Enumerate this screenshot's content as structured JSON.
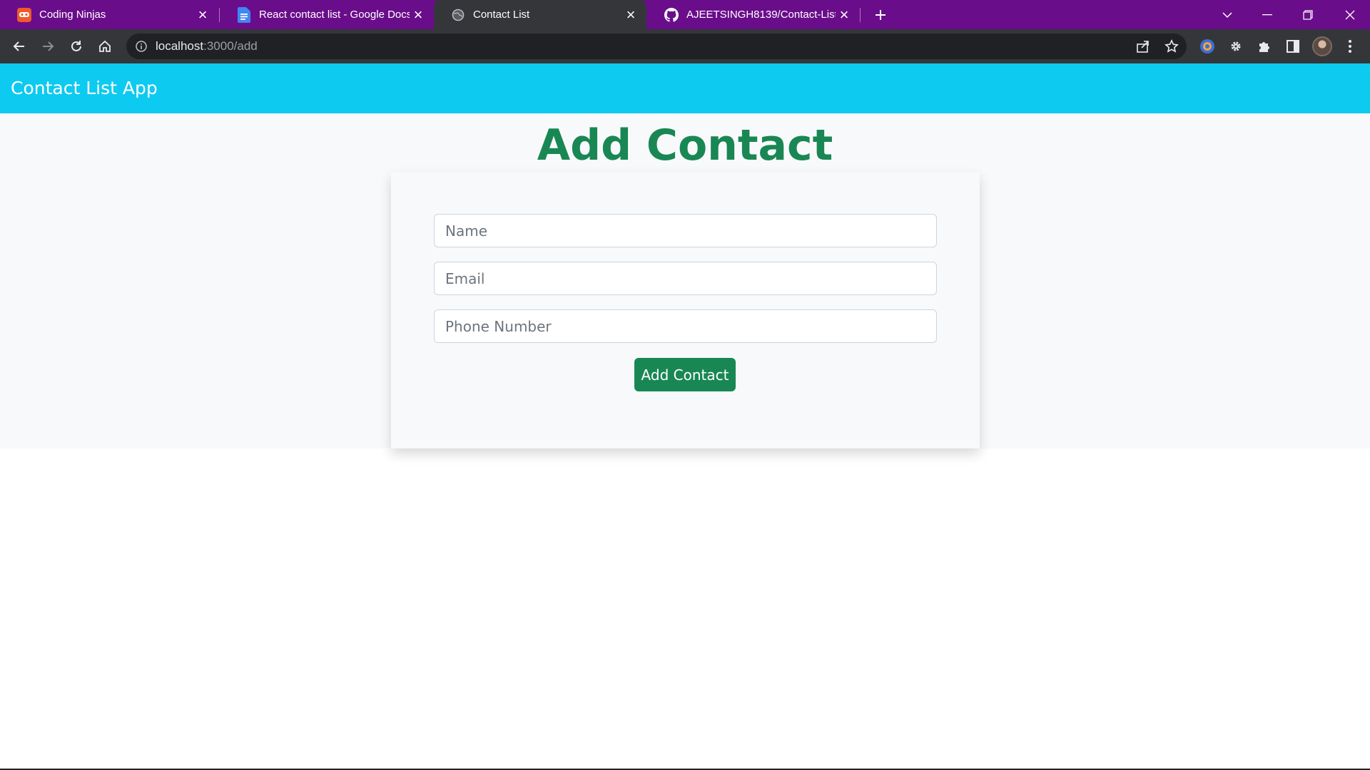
{
  "browser": {
    "tabs": [
      {
        "title": "Coding Ninjas",
        "icon": "coding-ninjas-icon",
        "active": false
      },
      {
        "title": "React contact list - Google Docs",
        "icon": "google-docs-icon",
        "active": false
      },
      {
        "title": "Contact List",
        "icon": "globe-icon",
        "active": true
      },
      {
        "title": "AJEETSINGH8139/Contact-List",
        "icon": "github-icon",
        "active": false
      }
    ],
    "url_host": "localhost",
    "url_path": ":3000/add",
    "colors": {
      "tabstrip": "#6a0d8a",
      "toolbar": "#35363a",
      "omnibox": "#202124"
    }
  },
  "app": {
    "brand": "Contact List App",
    "colors": {
      "navbar": "#0dcaf0",
      "accent": "#198754",
      "background": "#f8f9fa"
    }
  },
  "form": {
    "heading": "Add Contact",
    "name_placeholder": "Name",
    "email_placeholder": "Email",
    "phone_placeholder": "Phone Number",
    "name_value": "",
    "email_value": "",
    "phone_value": "",
    "submit_label": "Add Contact"
  }
}
